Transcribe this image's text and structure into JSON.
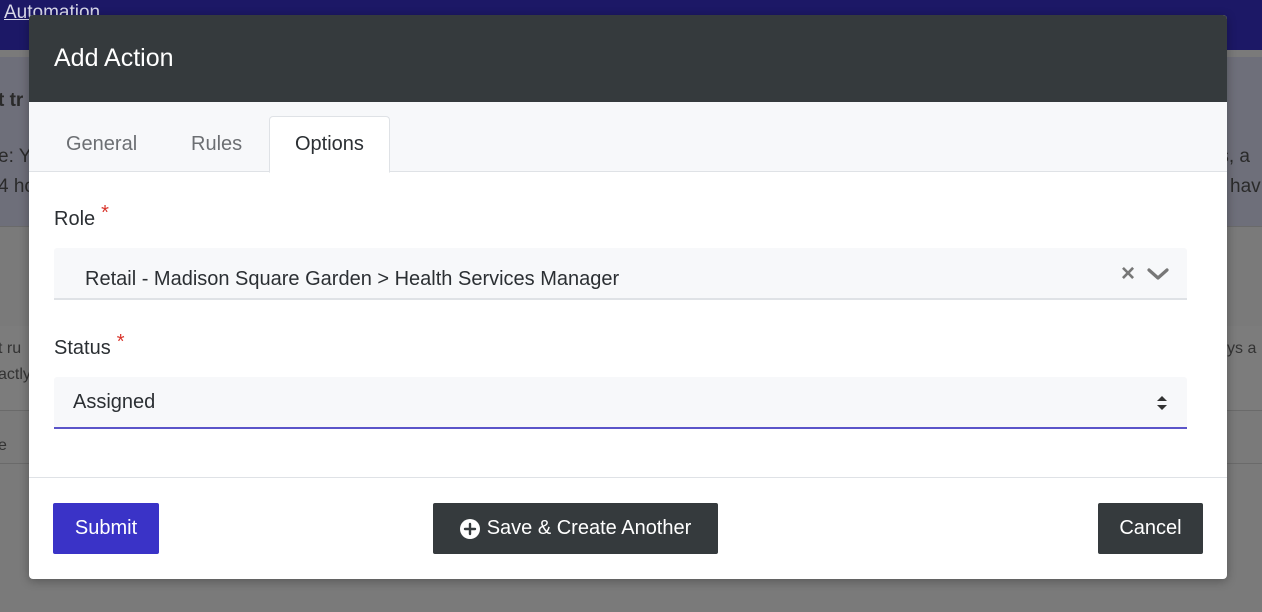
{
  "background": {
    "topbar_link": "Automation",
    "fragments": {
      "f1": "t tr",
      "f2": "e: Y",
      "f3": "4 ho",
      "f4": "rs, a",
      "f5": "hav",
      "f6": "t ru",
      "f7": "actly",
      "f8": "ys a",
      "f9": "e"
    }
  },
  "modal": {
    "title": "Add Action",
    "tabs": [
      {
        "label": "General",
        "active": false
      },
      {
        "label": "Rules",
        "active": false
      },
      {
        "label": "Options",
        "active": true
      }
    ],
    "fields": {
      "role": {
        "label": "Role",
        "required_mark": "*",
        "value": "Retail - Madison Square Garden > Health Services Manager",
        "clear_glyph": "×"
      },
      "status": {
        "label": "Status",
        "required_mark": "*",
        "value": "Assigned"
      }
    },
    "buttons": {
      "submit": "Submit",
      "save_create": "Save & Create Another",
      "cancel": "Cancel"
    }
  },
  "colors": {
    "primary": "#3a33c7",
    "dark": "#353a3d",
    "required": "#d9342b",
    "focus_underline": "#5b55c9"
  },
  "icons": {
    "clear": "x-icon",
    "dropdown": "chevron-down-icon",
    "select_arrows": "sort-arrows-icon",
    "save_create": "plus-circle-icon"
  }
}
